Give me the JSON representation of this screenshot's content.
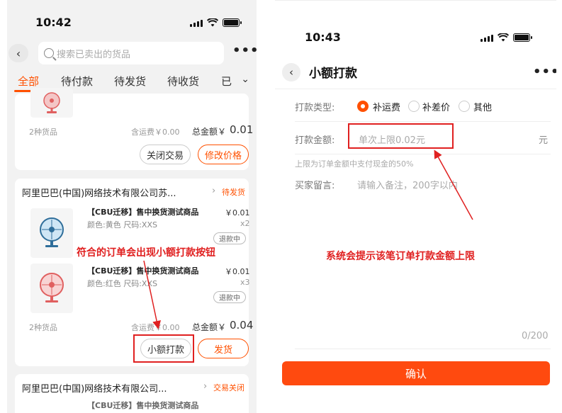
{
  "left": {
    "time": "10:42",
    "search_placeholder": "搜索已卖出的货品",
    "tabs": [
      "全部",
      "待付款",
      "待发货",
      "待收货",
      "已"
    ],
    "card1": {
      "goods_count": "2种货品",
      "shipping": "含运费￥0.00",
      "total_label": "总金额￥",
      "total_value": "0.01",
      "btn_close": "关闭交易",
      "btn_modify": "修改价格"
    },
    "card2": {
      "shop": "阿里巴巴(中国)网络技术有限公司苏...",
      "status": "待发货",
      "items": [
        {
          "title": "【CBU迁移】售中换货测试商品",
          "spec": "颜色:黄色 尺码:XXS",
          "price": "￥0.01",
          "qty": "x2",
          "refund": "退款中"
        },
        {
          "title": "【CBU迁移】售中换货测试商品",
          "spec": "颜色:红色 尺码:XXS",
          "price": "￥0.01",
          "qty": "x3",
          "refund": "退款中"
        }
      ],
      "goods_count": "2种货品",
      "shipping": "含运费￥0.00",
      "total_label": "总金额￥",
      "total_value": "0.04",
      "btn_small_pay": "小额打款",
      "btn_ship": "发货"
    },
    "card3": {
      "shop": "阿里巴巴(中国)网络技术有限公司...",
      "status": "交易关闭",
      "partial_title": "【CBU迁移】售中换货测试商品"
    },
    "annotation": "符合的订单会出现小额打款按钮"
  },
  "right": {
    "time": "10:43",
    "title": "小额打款",
    "type_label": "打款类型:",
    "options": [
      "补运费",
      "补差价",
      "其他"
    ],
    "selected_option": "补运费",
    "amount_label": "打款金额:",
    "amount_placeholder": "单次上限0.02元",
    "unit": "元",
    "hint": "上限为订单金额中支付现金的50%",
    "note_label": "买家留言:",
    "note_placeholder": "请输入备注，200字以内",
    "counter": "0/200",
    "confirm": "确认",
    "annotation": "系统会提示该笔订单打款金额上限"
  },
  "colors": {
    "accent": "#ff5000",
    "annotation": "#e02020"
  },
  "icons": [
    "signal-icon",
    "wifi-icon",
    "battery-icon",
    "back-icon",
    "search-icon",
    "more-icon",
    "chevron-down-icon",
    "chevron-right-icon",
    "fan-icon"
  ]
}
